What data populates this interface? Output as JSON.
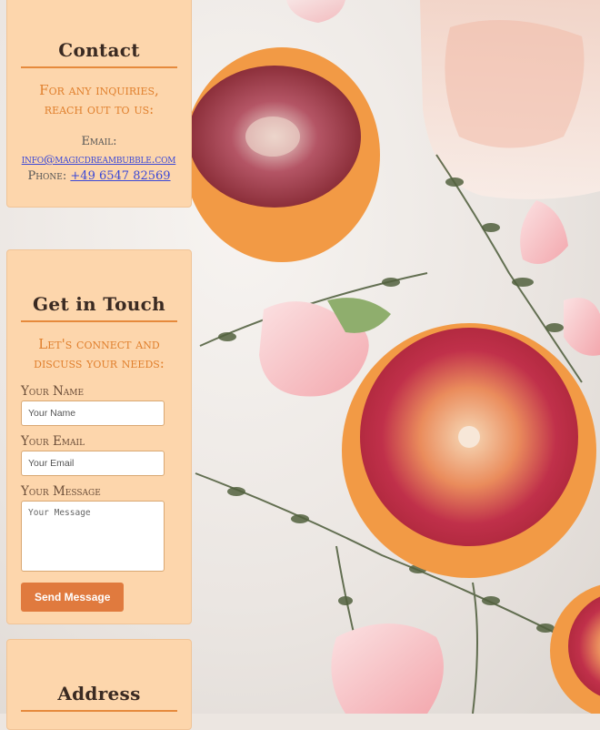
{
  "contact": {
    "title": "Contact",
    "subtitle": "For any inquiries, reach out to us:",
    "email_label": "Email:",
    "email": "info@magicdreambubble.com",
    "phone_label": "Phone:",
    "phone": "+49 6547 82569"
  },
  "touch": {
    "title": "Get in Touch",
    "subtitle": "Let's connect and discuss your needs:",
    "name_label": "Your Name",
    "name_placeholder": "Your Name",
    "email_label": "Your Email",
    "email_placeholder": "Your Email",
    "message_label": "Your Message",
    "message_placeholder": "Your Message",
    "button_label": "Send Message"
  },
  "address": {
    "title": "Address"
  },
  "colors": {
    "card_bg": "#fdd6ac",
    "accent": "#e07a3e",
    "title": "#3a2a22",
    "link": "#3b48d6"
  }
}
